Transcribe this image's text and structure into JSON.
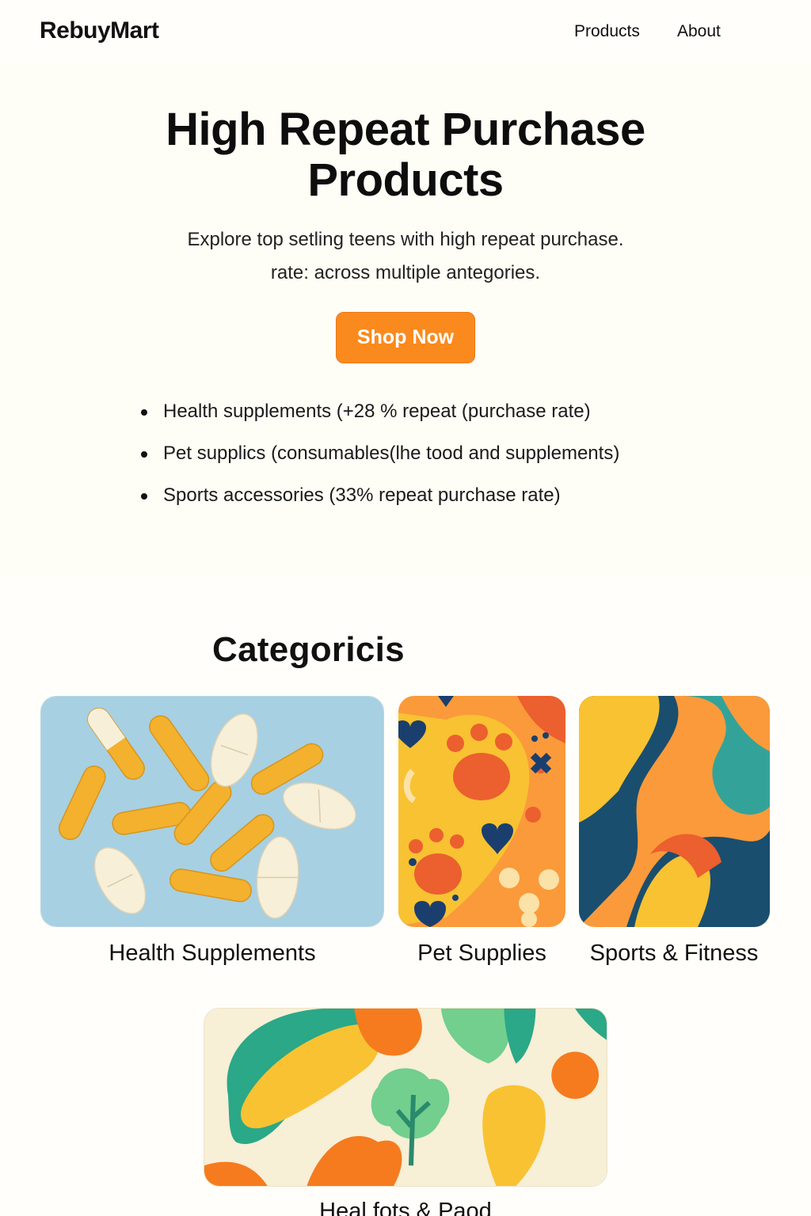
{
  "header": {
    "logo": "RebuyMart",
    "nav": [
      {
        "label": "Products"
      },
      {
        "label": "About"
      }
    ]
  },
  "hero": {
    "title": "High Repeat Purchase Products",
    "subtitle_line1": "Explore top setling teens with high repeat purchase.",
    "subtitle_line2": "rate: across multiple antegories.",
    "cta_label": "Shop Now",
    "bullets": [
      "Health supplements (+28 % repeat  (purchase rate)",
      "Pet supplics (consumables(lhe tood and supplements)",
      "Sports accessories (33% repeat purchase rate)"
    ]
  },
  "categories": {
    "title": "Categoricis",
    "items": [
      {
        "label": "Health Supplements",
        "image": "capsules-illustration"
      },
      {
        "label": "Pet Supplies",
        "image": "paw-prints-illustration"
      },
      {
        "label": "Sports & Fitness",
        "image": "abstract-waves-illustration"
      },
      {
        "label": "Heal fots & Paod",
        "image": "vegetables-illustration"
      }
    ]
  },
  "colors": {
    "accent": "#fb8a1e",
    "background": "#fffefa",
    "capsule_orange": "#f3b12d",
    "capsule_cream": "#f7efd8",
    "card_blue": "#a7d0e2"
  }
}
